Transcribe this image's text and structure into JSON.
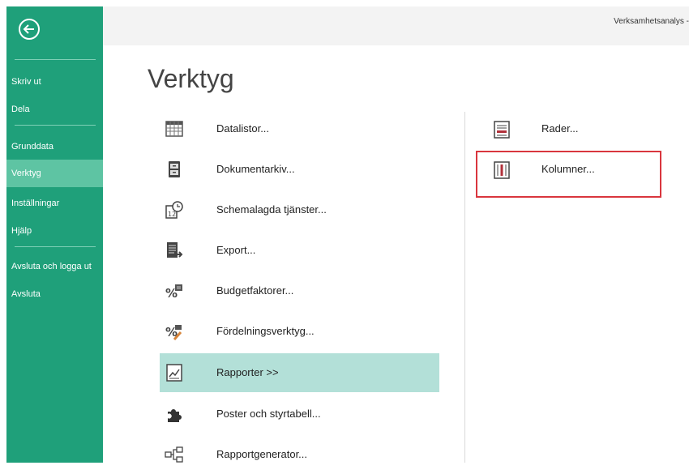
{
  "colors": {
    "sidebar": "#1fa07a",
    "sidebar_active": "#5ec4a3",
    "selected_item": "#b3e0d8",
    "highlight_border": "#d9363e"
  },
  "app_title": "Verksamhetsanalys -",
  "page_title": "Verktyg",
  "sidebar": {
    "back_icon": "back-arrow-icon",
    "items": [
      {
        "label": "Skriv ut"
      },
      {
        "label": "Dela"
      },
      {
        "label": "Grunddata"
      },
      {
        "label": "Verktyg",
        "active": true
      },
      {
        "label": "Inställningar"
      },
      {
        "label": "Hjälp"
      },
      {
        "label": "Avsluta och logga ut"
      },
      {
        "label": "Avsluta"
      }
    ]
  },
  "tools": [
    {
      "label": "Datalistor...",
      "icon": "grid-table-icon"
    },
    {
      "label": "Dokumentarkiv...",
      "icon": "document-archive-icon"
    },
    {
      "label": "Schemalagda tjänster...",
      "icon": "calendar-clock-icon"
    },
    {
      "label": "Export...",
      "icon": "export-icon"
    },
    {
      "label": "Budgetfaktorer...",
      "icon": "percent-factor-icon"
    },
    {
      "label": "Fördelningsverktyg...",
      "icon": "percent-brush-icon"
    },
    {
      "label": "Rapporter >>",
      "icon": "report-chart-icon",
      "selected": true
    },
    {
      "label": "Poster och styrtabell...",
      "icon": "puzzle-piece-icon"
    },
    {
      "label": "Rapportgenerator...",
      "icon": "hierarchy-icon"
    }
  ],
  "reports": [
    {
      "label": "Rader...",
      "icon": "report-rows-icon"
    },
    {
      "label": "Kolumner...",
      "icon": "report-columns-icon",
      "highlighted": true
    }
  ]
}
